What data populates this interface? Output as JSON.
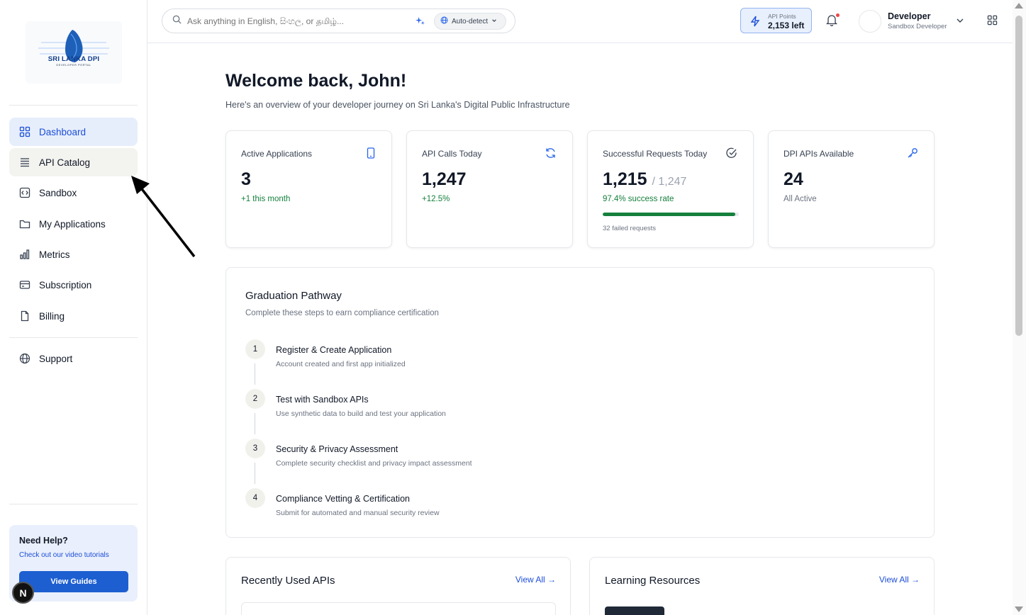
{
  "sidebar": {
    "logo": {
      "line1": "SRI LANKA DPI",
      "line2": "DEVELOPER PORTAL"
    },
    "items": [
      {
        "label": "Dashboard",
        "icon": "grid-icon",
        "active": true
      },
      {
        "label": "API Catalog",
        "icon": "list-icon",
        "hover": true
      },
      {
        "label": "Sandbox",
        "icon": "code-box-icon"
      },
      {
        "label": "My Applications",
        "icon": "folder-icon"
      },
      {
        "label": "Metrics",
        "icon": "bar-chart-icon"
      },
      {
        "label": "Subscription",
        "icon": "credit-card-icon"
      },
      {
        "label": "Billing",
        "icon": "file-icon"
      },
      {
        "label": "Support",
        "icon": "globe-icon"
      }
    ],
    "help": {
      "title": "Need Help?",
      "subtitle": "Check out our video tutorials",
      "button": "View Guides"
    },
    "badge": "N"
  },
  "header": {
    "search_placeholder": "Ask anything in English, සිංහල, or தமிழ்...",
    "language": "Auto-detect",
    "points_label": "API Points",
    "points_value": "2,153 left",
    "user_name": "Developer",
    "user_role": "Sandbox Developer"
  },
  "main": {
    "title": "Welcome back, John!",
    "subtitle": "Here's an overview of your developer journey on Sri Lanka's Digital Public Infrastructure",
    "stats": [
      {
        "title": "Active Applications",
        "value": "3",
        "sub": "+1 this month",
        "icon": "phone-icon"
      },
      {
        "title": "API Calls Today",
        "value": "1,247",
        "sub": "+12.5%",
        "icon": "refresh-icon"
      },
      {
        "title": "Successful Requests Today",
        "value": "1,215",
        "of": "/ 1,247",
        "sub": "97.4% success rate",
        "progress": 0.974,
        "note": "32 failed requests",
        "icon": "check-circle-icon"
      },
      {
        "title": "DPI APIs Available",
        "value": "24",
        "sub": "All Active",
        "icon": "key-icon"
      }
    ],
    "pathway": {
      "title": "Graduation Pathway",
      "subtitle": "Complete these steps to earn compliance certification",
      "steps": [
        {
          "num": "1",
          "title": "Register & Create Application",
          "desc": "Account created and first app initialized"
        },
        {
          "num": "2",
          "title": "Test with Sandbox APIs",
          "desc": "Use synthetic data to build and test your application"
        },
        {
          "num": "3",
          "title": "Security & Privacy Assessment",
          "desc": "Complete security checklist and privacy impact assessment"
        },
        {
          "num": "4",
          "title": "Compliance Vetting & Certification",
          "desc": "Submit for automated and manual security review"
        }
      ]
    },
    "recent": {
      "title": "Recently Used APIs",
      "link": "View All →"
    },
    "learning": {
      "title": "Learning Resources",
      "link": "View All →"
    }
  },
  "colors": {
    "accent": "#1d4ed8",
    "success": "#15803d",
    "active_bg": "#e6eefc"
  }
}
